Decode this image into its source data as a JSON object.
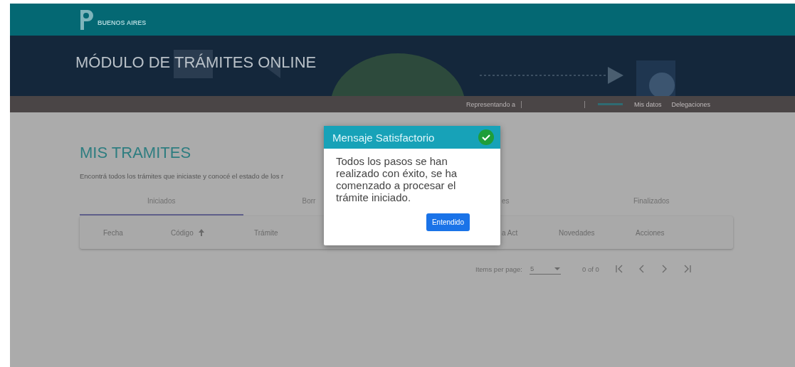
{
  "header": {
    "logo_text": "BUENOS AIRES"
  },
  "banner": {
    "title": "MÓDULO DE TRÁMITES ONLINE"
  },
  "nav": {
    "representing_label": "Representando a",
    "links": [
      "Mis datos",
      "Delegaciones"
    ]
  },
  "page": {
    "title": "MIS TRAMITES",
    "intro": "Encontrá todos los trámites que iniciaste y conocé el estado de los r"
  },
  "tabs": [
    {
      "label": "Iniciados",
      "selected": true
    },
    {
      "label": "Borr",
      "selected": false
    },
    {
      "label": "es",
      "selected": false
    },
    {
      "label": "Finalizados",
      "selected": false
    }
  ],
  "table": {
    "columns": [
      {
        "label": "Fecha"
      },
      {
        "label": "Código",
        "sorted": true
      },
      {
        "label": "Trámite"
      },
      {
        "label": "a Act"
      },
      {
        "label": "Novedades"
      },
      {
        "label": "Acciones"
      }
    ]
  },
  "paginator": {
    "items_per_page_label": "Items per page:",
    "page_size": "5",
    "range": "0 of 0"
  },
  "dialog": {
    "title": "Mensaje Satisfactorio",
    "message": "Todos los pasos se han realizado con éxito, se ha comenzado a procesar el trámite iniciado.",
    "buttons": [
      "Entendido"
    ]
  }
}
